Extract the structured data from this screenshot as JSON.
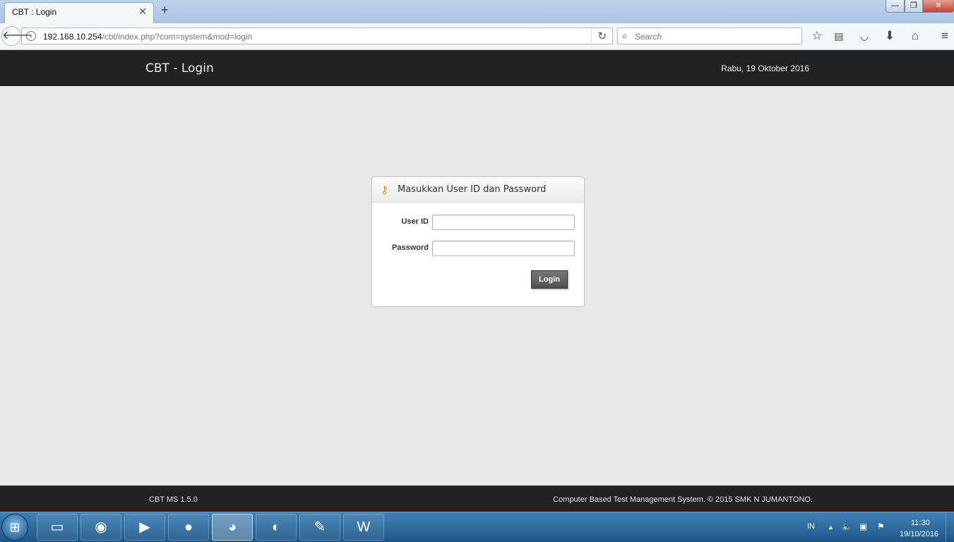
{
  "browser": {
    "tab_title": "CBT : Login",
    "tab_close": "✕",
    "new_tab": "+",
    "url_host": "192.168.10.254",
    "url_path": "/cbt/index.php?com=system&mod=login",
    "search_placeholder": "Search",
    "window_controls": {
      "minimize": "—",
      "maximize": "❐",
      "close": "✕"
    },
    "toolbar_icons": [
      "star-icon",
      "reading-list-icon",
      "pocket-icon",
      "download-icon",
      "home-icon",
      "menu-icon"
    ]
  },
  "app": {
    "title": "CBT - Login",
    "date": "Rabu, 19 Oktober 2016"
  },
  "login": {
    "panel_title": "Masukkan User ID dan Password",
    "userid_label": "User ID",
    "userid_value": "",
    "password_label": "Password",
    "password_value": "",
    "button_label": "Login"
  },
  "footer": {
    "version": "CBT MS 1.5.0",
    "copyright": "Computer Based Test Management System. © 2015 SMK N JUMANTONO."
  },
  "taskbar": {
    "apps": [
      "file-explorer-icon",
      "chrome-icon",
      "media-player-icon",
      "app-icon",
      "firefox-icon",
      "browser-icon",
      "paint-icon",
      "word-icon"
    ],
    "active_app": "firefox-icon",
    "language": "IN",
    "clock_time": "11:30",
    "clock_date": "19/10/2016"
  },
  "colors": {
    "header_bg": "#222222",
    "page_bg": "#e8e8e8",
    "taskbar_bg": "#1e5786",
    "login_button_bg": "#5a5a5a"
  }
}
